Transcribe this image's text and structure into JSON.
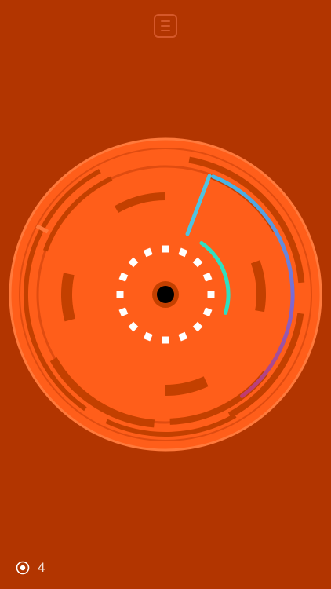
{
  "game": {
    "colors": {
      "background": "#b23500",
      "board": "#ff5e1a",
      "ring_frame": "#ff6a2a",
      "wall": "#c34000",
      "dots": "#ffffff",
      "hole": "#000000",
      "path_start": "#6a8fe0",
      "path_end": "#33e0c4",
      "icon": "#d5582a"
    },
    "menu_icon": "hamburger-menu-icon",
    "level": {
      "icon": "target-icon",
      "number": "4"
    }
  }
}
